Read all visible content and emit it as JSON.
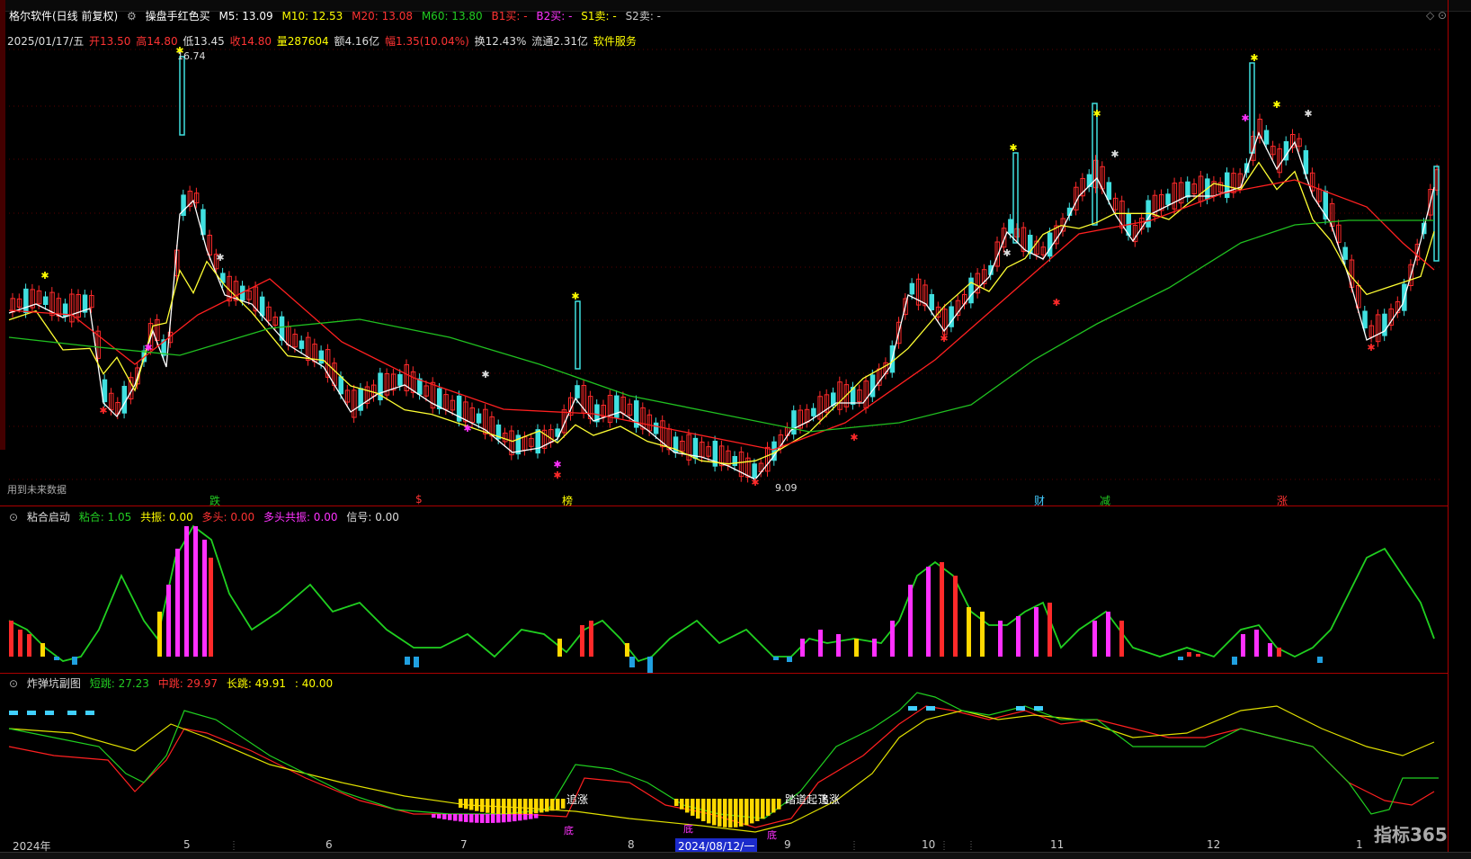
{
  "header": {
    "stock_name": "格尔软件(日线 前复权)",
    "indicator": "操盘手红色买",
    "ma5": "M5: 13.09",
    "ma10": "M10: 12.53",
    "ma20": "M20: 13.08",
    "ma60": "M60: 13.80",
    "b1": "B1买: -",
    "b2": "B2买: -",
    "s1": "S1卖: -",
    "s2": "S2卖: -"
  },
  "info": {
    "date": "2025/01/17/五",
    "open": "开13.50",
    "high": "高14.80",
    "low": "低13.45",
    "close": "收14.80",
    "volume": "量287604",
    "amount": "额4.16亿",
    "change": "幅1.35(10.04%)",
    "turnover": "换12.43%",
    "float_cap": "流通2.31亿",
    "sector": "软件服务"
  },
  "price_labels": {
    "high": "16.74",
    "low": "9.09",
    "future_note": "用到未来数据"
  },
  "signal_labels": [
    "跌",
    "$",
    "榜",
    "财",
    "减",
    "涨"
  ],
  "panel2": {
    "name": "粘合启动",
    "v1": "粘合: 1.05",
    "v2": "共振: 0.00",
    "v3": "多头: 0.00",
    "v4": "多头共振: 0.00",
    "v5": "信号: 0.00"
  },
  "panel3": {
    "name": "炸弹坑副图",
    "v1": "短跳: 27.23",
    "v2": "中跳: 29.97",
    "v3": "长跳: 49.91",
    "v4": ": 40.00",
    "labels": [
      "追涨",
      "底",
      "底",
      "底",
      "踏道起飞",
      "追涨"
    ]
  },
  "dates": [
    "2024年",
    "5",
    "6",
    "7",
    "8",
    "2024/08/12/一",
    "9",
    "10",
    "11",
    "12",
    "1"
  ],
  "watermark": "指标365",
  "colors": {
    "up": "#ff2a2a",
    "down": "#40e0e0",
    "ma5": "#ffffff",
    "ma10": "#ffff33",
    "ma20": "#ff2020",
    "ma60": "#20c020",
    "magenta": "#ff30ff",
    "yellow_bar": "#ffd800"
  }
}
